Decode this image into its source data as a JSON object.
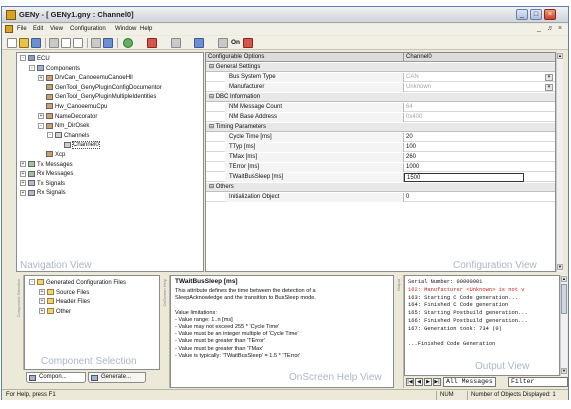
{
  "window": {
    "title": "GENy - [ GENy1.gny : Channel0]",
    "controls": [
      "_",
      "□",
      "×"
    ]
  },
  "menubar": {
    "items": [
      "File",
      "Edit",
      "View",
      "Configuration",
      "Window",
      "Help"
    ],
    "mdi_controls": [
      "_",
      "♬",
      "×"
    ]
  },
  "toolbar": {
    "icons": [
      "new-icon",
      "open-icon",
      "save-icon",
      "cut-icon",
      "copy-icon",
      "paste-icon",
      "print-icon",
      "help-icon",
      "add-icon",
      "remove-icon",
      "wrench-icon",
      "generate-icon",
      "settings-icon",
      "on-icon"
    ],
    "on_label": "On"
  },
  "navigation": {
    "watermark": "Navigation View",
    "tree": [
      {
        "label": "ECU",
        "depth": 0,
        "expander": "-",
        "icon": "ecu"
      },
      {
        "label": "Components",
        "depth": 1,
        "expander": "-",
        "icon": "comp"
      },
      {
        "label": "DrvCan_CanoeemuCanoeHll",
        "depth": 2,
        "expander": "+",
        "icon": "cube"
      },
      {
        "label": "GenTool_GenyPluginConfigDocumentor",
        "depth": 2,
        "expander": "",
        "icon": "cube"
      },
      {
        "label": "GenTool_GenyPluginMultipleIdentities",
        "depth": 2,
        "expander": "",
        "icon": "cube"
      },
      {
        "label": "Hw_CanoeemuCpu",
        "depth": 2,
        "expander": "",
        "icon": "cube"
      },
      {
        "label": "NameDecorator",
        "depth": 2,
        "expander": "+",
        "icon": "cube"
      },
      {
        "label": "Nm_DirOsek",
        "depth": 2,
        "expander": "-",
        "icon": "cube"
      },
      {
        "label": "Channels",
        "depth": 3,
        "expander": "-",
        "icon": "chan"
      },
      {
        "label": "Channel0",
        "depth": 4,
        "expander": "",
        "icon": "chan",
        "selected": true
      },
      {
        "label": "Xcp",
        "depth": 2,
        "expander": "",
        "icon": "cube"
      },
      {
        "label": "Tx Messages",
        "depth": 0,
        "expander": "+",
        "icon": "msg"
      },
      {
        "label": "Rx Messages",
        "depth": 0,
        "expander": "+",
        "icon": "msg"
      },
      {
        "label": "Tx Signals",
        "depth": 0,
        "expander": "+",
        "icon": "sig"
      },
      {
        "label": "Rx Signals",
        "depth": 0,
        "expander": "+",
        "icon": "sig"
      }
    ]
  },
  "configuration": {
    "watermark": "Configuration View",
    "col_options": "Configurable Options",
    "col_value": "Channel0",
    "rows": [
      {
        "kind": "section",
        "label": "General Settings"
      },
      {
        "kind": "row",
        "name": "Bus System Type",
        "value": "CAN",
        "disabled": true,
        "dropdown": true
      },
      {
        "kind": "row",
        "name": "Manufacturer",
        "value": "Unknown",
        "disabled": true,
        "dropdown": true
      },
      {
        "kind": "section",
        "label": "DBC Information"
      },
      {
        "kind": "row",
        "name": "NM Message Count",
        "value": "64",
        "disabled": true
      },
      {
        "kind": "row",
        "name": "NM Base Address",
        "value": "0x400",
        "disabled": true
      },
      {
        "kind": "section",
        "label": "Timing Parameters"
      },
      {
        "kind": "row",
        "name": "Cycle Time [ms]",
        "value": "20"
      },
      {
        "kind": "row",
        "name": "TTyp [ms]",
        "value": "100"
      },
      {
        "kind": "row",
        "name": "TMax [ms]",
        "value": "260"
      },
      {
        "kind": "row",
        "name": "TError [ms]",
        "value": "1000"
      },
      {
        "kind": "row",
        "name": "TWaitBusSleep [ms]",
        "value": "1500",
        "editing": true
      },
      {
        "kind": "section",
        "label": "Others"
      },
      {
        "kind": "row",
        "name": "Initialization Object",
        "value": "0"
      }
    ]
  },
  "component_selection": {
    "watermark": "Component Selection",
    "strip_label": "Component Selection",
    "tree": [
      {
        "label": "Generated Configuration Files",
        "depth": 0,
        "expander": "-"
      },
      {
        "label": "Source Files",
        "depth": 1,
        "expander": "+"
      },
      {
        "label": "Header Files",
        "depth": 1,
        "expander": "+"
      },
      {
        "label": "Other",
        "depth": 1,
        "expander": "+"
      }
    ],
    "tabs": [
      "Compon...",
      "Generate..."
    ]
  },
  "help": {
    "watermark": "OnScreen Help View",
    "strip_label": "OnScreen Help",
    "title": "TWaitBusSleep [ms]",
    "lines": [
      "This attribute defines the time between the detection of a",
      "SleepAcknowledge and the transition to BusSleep mode.",
      "",
      "Value limitations:",
      "- Value range: 1..n [ms]",
      "- Value may not exceed 255 * 'Cycle Time'",
      "- Value must be an integer multiple of 'Cycle Time'",
      "- Value must be greater than 'TError'",
      "- Value must be greater than 'TMax'",
      "- Value is typically: 'TWaitBusSleep' = 1.5 * 'TError'"
    ]
  },
  "output": {
    "watermark": "Output View",
    "strip_label": "Output",
    "lines": [
      {
        "text": "Serial Number: 00000001",
        "error": false
      },
      {
        "text": "162: Manufacturer <Unknown> is not v",
        "error": true
      },
      {
        "text": "163: Starting C Code generation...",
        "error": false
      },
      {
        "text": "164: Finished C Code generation",
        "error": false
      },
      {
        "text": "165: Starting Postbuild generation...",
        "error": false
      },
      {
        "text": "166: Finished Postbuild generation...",
        "error": false
      },
      {
        "text": "167: Generation took: 734 (0)",
        "error": false
      },
      {
        "text": "",
        "error": false
      },
      {
        "text": "...Finished Code Generation",
        "error": false
      }
    ],
    "filter_tabs": [
      "All Messages",
      "Filter"
    ]
  },
  "statusbar": {
    "hint": "For Help, press F1",
    "num": "NUM",
    "objects": "Number of Objects Displayed: 1"
  }
}
